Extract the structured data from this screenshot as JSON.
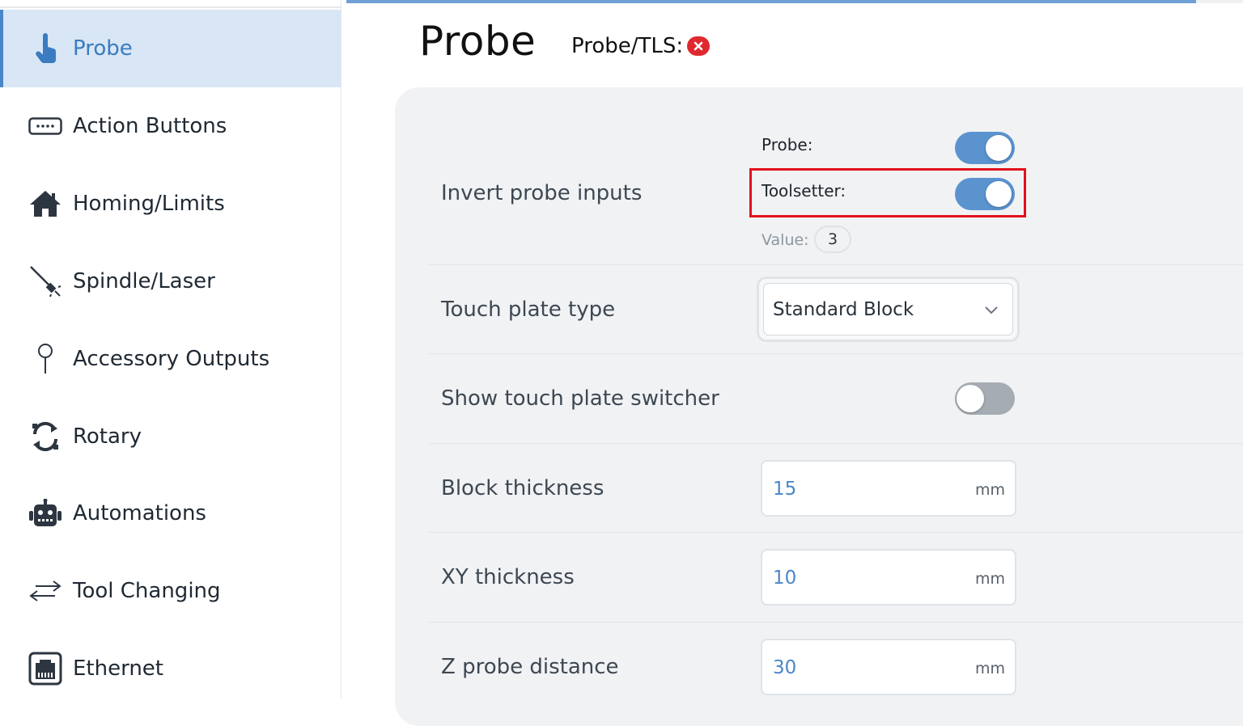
{
  "sidebar": {
    "items": [
      {
        "label": "Probe",
        "icon": "pointer-hand-icon",
        "active": true
      },
      {
        "label": "Action Buttons",
        "icon": "keyboard-button-icon"
      },
      {
        "label": "Homing/Limits",
        "icon": "home-icon"
      },
      {
        "label": "Spindle/Laser",
        "icon": "spindle-laser-icon"
      },
      {
        "label": "Accessory Outputs",
        "icon": "pin-icon"
      },
      {
        "label": "Rotary",
        "icon": "rotate-icon"
      },
      {
        "label": "Automations",
        "icon": "robot-icon"
      },
      {
        "label": "Tool Changing",
        "icon": "swap-arrows-icon"
      },
      {
        "label": "Ethernet",
        "icon": "ethernet-port-icon"
      }
    ]
  },
  "header": {
    "title": "Probe",
    "status_label": "Probe/TLS:",
    "status_icon": "error-x-icon",
    "status_color": "#e0292f"
  },
  "settings": {
    "invert_probe": {
      "label": "Invert probe inputs",
      "probe_label": "Probe:",
      "probe_on": true,
      "toolsetter_label": "Toolsetter:",
      "toolsetter_on": true,
      "value_label": "Value:",
      "value": "3"
    },
    "touch_plate_type": {
      "label": "Touch plate type",
      "selected": "Standard Block"
    },
    "show_switcher": {
      "label": "Show touch plate switcher",
      "on": false
    },
    "block_thickness": {
      "label": "Block thickness",
      "value": "15",
      "unit": "mm"
    },
    "xy_thickness": {
      "label": "XY thickness",
      "value": "10",
      "unit": "mm"
    },
    "z_probe_distance": {
      "label": "Z probe distance",
      "value": "30",
      "unit": "mm"
    }
  },
  "colors": {
    "accent": "#4a86c8",
    "active_bg": "#d8e6f5",
    "highlight": "#e0111b"
  }
}
